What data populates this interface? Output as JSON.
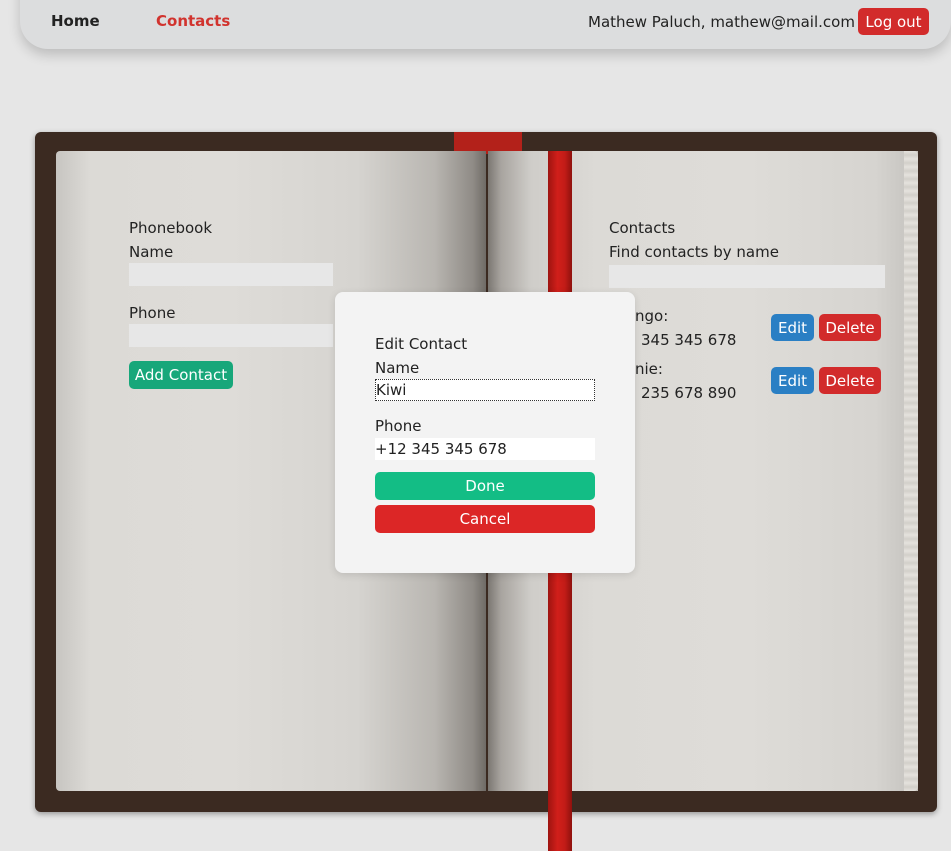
{
  "nav": {
    "home_label": "Home",
    "contacts_label": "Contacts",
    "user_info": "Mathew Paluch, mathew@mail.com",
    "logout_label": "Log out"
  },
  "phonebook": {
    "title": "Phonebook",
    "name_label": "Name",
    "name_value": "",
    "phone_label": "Phone",
    "phone_value": "",
    "add_button": "Add Contact"
  },
  "contacts": {
    "title": "Contacts",
    "filter_label": "Find contacts by name",
    "filter_value": "",
    "items": [
      {
        "name_partial": "ngo:",
        "phone_partial": "345 345 678",
        "edit_label": "Edit",
        "delete_label": "Delete"
      },
      {
        "name_partial": "nie:",
        "phone_partial": "235 678 890",
        "edit_label": "Edit",
        "delete_label": "Delete"
      }
    ]
  },
  "modal": {
    "title": "Edit Contact",
    "name_label": "Name",
    "name_value": "Kiwi",
    "phone_label": "Phone",
    "phone_value": "+12 345 345 678",
    "done_label": "Done",
    "cancel_label": "Cancel"
  },
  "colors": {
    "accent_red": "#d22b2b",
    "add_green": "#17a77a",
    "done_green": "#13bd85",
    "edit_blue": "#2a7fc4",
    "ribbon_red": "#c21c17"
  }
}
